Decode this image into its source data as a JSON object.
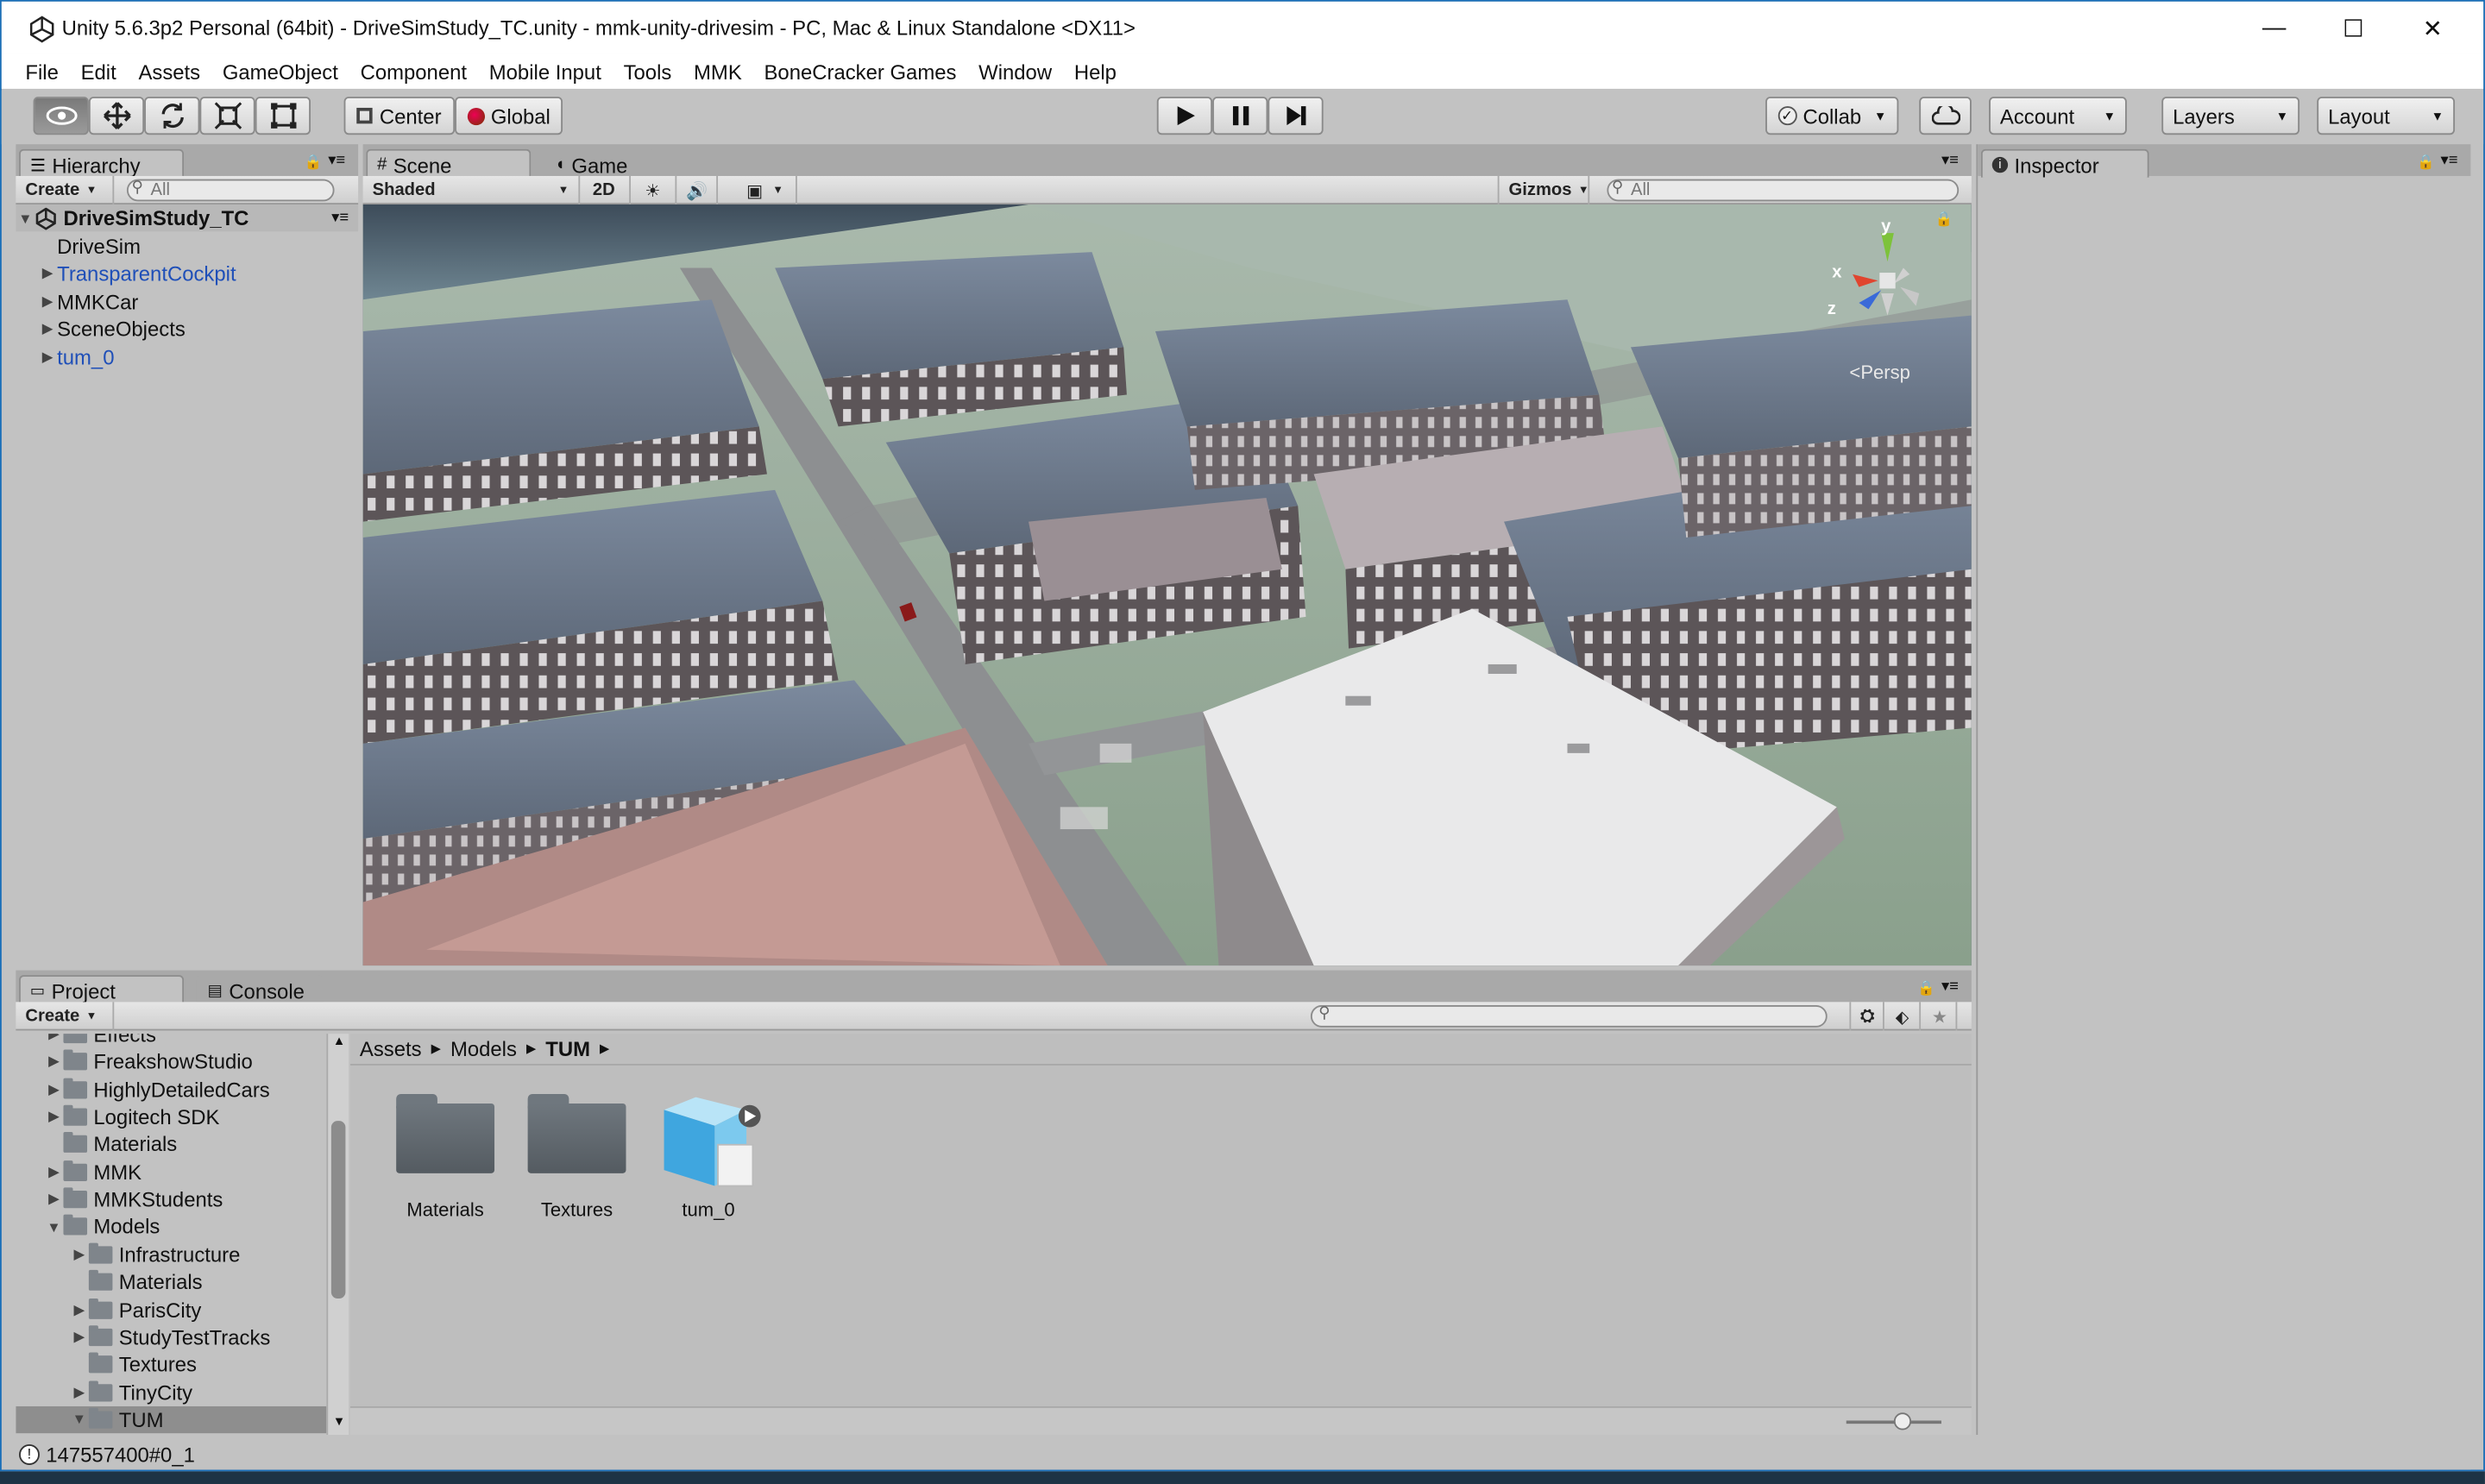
{
  "window": {
    "title": "Unity 5.6.3p2 Personal (64bit) - DriveSimStudy_TC.unity - mmk-unity-drivesim - PC, Mac & Linux Standalone <DX11>",
    "minimize": "—",
    "maximize": "☐",
    "close": "✕"
  },
  "menu": [
    "File",
    "Edit",
    "Assets",
    "GameObject",
    "Component",
    "Mobile Input",
    "Tools",
    "MMK",
    "BoneCracker Games",
    "Window",
    "Help"
  ],
  "toolbar": {
    "pivot_mode": "Center",
    "pivot_space": "Global",
    "collab": "Collab",
    "account": "Account",
    "layers": "Layers",
    "layout": "Layout"
  },
  "hierarchy": {
    "tab": "Hierarchy",
    "create": "Create",
    "search_placeholder": "All",
    "scene_name": "DriveSimStudy_TC",
    "items": [
      {
        "label": "DriveSim",
        "prefab": false,
        "expandable": false
      },
      {
        "label": "TransparentCockpit",
        "prefab": true,
        "expandable": true
      },
      {
        "label": "MMKCar",
        "prefab": false,
        "expandable": true
      },
      {
        "label": "SceneObjects",
        "prefab": false,
        "expandable": true
      },
      {
        "label": "tum_0",
        "prefab": true,
        "expandable": true
      }
    ]
  },
  "scene": {
    "tab_scene": "Scene",
    "tab_game": "Game",
    "shading": "Shaded",
    "mode_2d": "2D",
    "gizmos": "Gizmos",
    "search_placeholder": "All",
    "axis_x": "x",
    "axis_y": "y",
    "axis_z": "z",
    "projection": "Persp"
  },
  "inspector": {
    "tab": "Inspector"
  },
  "project": {
    "tab_project": "Project",
    "tab_console": "Console",
    "create": "Create",
    "tree": [
      {
        "label": "Effects",
        "depth": 1,
        "arrow": true,
        "open": false
      },
      {
        "label": "FreakshowStudio",
        "depth": 1,
        "arrow": true,
        "open": false
      },
      {
        "label": "HighlyDetailedCars",
        "depth": 1,
        "arrow": true,
        "open": false
      },
      {
        "label": "Logitech SDK",
        "depth": 1,
        "arrow": true,
        "open": false
      },
      {
        "label": "Materials",
        "depth": 1,
        "arrow": false,
        "open": false
      },
      {
        "label": "MMK",
        "depth": 1,
        "arrow": true,
        "open": false
      },
      {
        "label": "MMKStudents",
        "depth": 1,
        "arrow": true,
        "open": false
      },
      {
        "label": "Models",
        "depth": 1,
        "arrow": true,
        "open": true
      },
      {
        "label": "Infrastructure",
        "depth": 2,
        "arrow": true,
        "open": false
      },
      {
        "label": "Materials",
        "depth": 2,
        "arrow": false,
        "open": false
      },
      {
        "label": "ParisCity",
        "depth": 2,
        "arrow": true,
        "open": false
      },
      {
        "label": "StudyTestTracks",
        "depth": 2,
        "arrow": true,
        "open": false
      },
      {
        "label": "Textures",
        "depth": 2,
        "arrow": false,
        "open": false
      },
      {
        "label": "TinyCity",
        "depth": 2,
        "arrow": true,
        "open": false
      },
      {
        "label": "TUM",
        "depth": 2,
        "arrow": true,
        "open": true
      }
    ],
    "breadcrumb": [
      "Assets",
      "Models",
      "TUM"
    ],
    "assets": [
      {
        "label": "Materials",
        "kind": "folder"
      },
      {
        "label": "Textures",
        "kind": "folder"
      },
      {
        "label": "tum_0",
        "kind": "model"
      }
    ]
  },
  "status": {
    "message": "147557400#0_1"
  },
  "colors": {
    "panel": "#c2c2c2",
    "tabstrip": "#a9a9a9",
    "prefab_blue": "#1f4fb8",
    "selection": "#8e8e8e",
    "accent": "#1a6fb8"
  }
}
